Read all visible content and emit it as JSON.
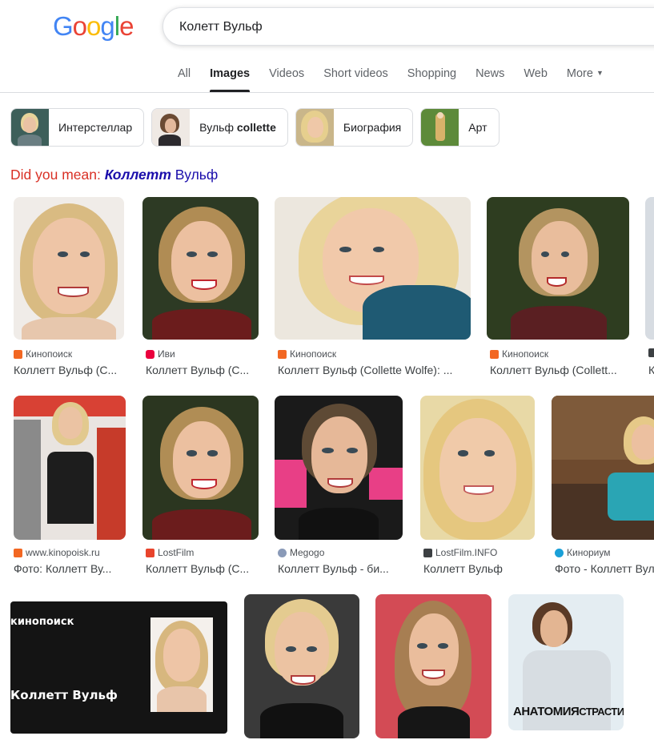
{
  "logo": [
    "G",
    "o",
    "o",
    "g",
    "l",
    "e"
  ],
  "logo_colors": [
    "#4285f4",
    "#ea4335",
    "#fbbc05",
    "#4285f4",
    "#34a853",
    "#ea4335"
  ],
  "search": {
    "value": "Колетт Вульф"
  },
  "tabs": [
    {
      "label": "All"
    },
    {
      "label": "Images",
      "active": true
    },
    {
      "label": "Videos"
    },
    {
      "label": "Short videos"
    },
    {
      "label": "Shopping"
    },
    {
      "label": "News"
    },
    {
      "label": "Web"
    },
    {
      "label": "More",
      "icon": "caret-down-icon"
    }
  ],
  "chips": [
    {
      "label": "Интерстеллар"
    },
    {
      "label_prefix": "Вульф ",
      "label_bold": "collette"
    },
    {
      "label": "Биография"
    },
    {
      "label": "Арт"
    }
  ],
  "spelling": {
    "prefix": "Did you mean: ",
    "suggestion_bold": "Коллетт",
    "suggestion_rest": " Вульф"
  },
  "results": [
    {
      "source": "Кинопоиск",
      "caption": "Коллетт Вульф (C...",
      "fav_color": "#f26722"
    },
    {
      "source": "Иви",
      "caption": "Коллетт Вульф (C...",
      "fav_color": "#ea003d"
    },
    {
      "source": "Кинопоиск",
      "caption": "Коллетт Вульф (Collette Wolfe): ...",
      "fav_color": "#f26722"
    },
    {
      "source": "Кинопоиск",
      "caption": "Коллетт Вульф (Collett...",
      "fav_color": "#f26722"
    },
    {
      "source": "",
      "caption": "К",
      "fav_color": "#3c4043"
    },
    {
      "source": "www.kinopoisk.ru",
      "caption": "Фото: Коллетт Ву...",
      "fav_color": "#f26722"
    },
    {
      "source": "LostFilm",
      "caption": "Коллетт Вульф (C...",
      "fav_color": "#e8442c"
    },
    {
      "source": "Megogo",
      "caption": "Коллетт Вульф - би...",
      "fav_color": "#8a9ab8"
    },
    {
      "source": "LostFilm.INFO",
      "caption": "Коллетт Вульф",
      "fav_color": "#3c4043"
    },
    {
      "source": "Кинориум",
      "caption": "Фото - Коллетт Вул",
      "fav_color": "#1aa0d8"
    }
  ],
  "promo_tile": {
    "brand": "кинопоиск",
    "name": "Коллетт Вульф"
  },
  "poster_tile": {
    "title_left": "АНАТОМИЯ",
    "title_right": "СТРАСТИ"
  }
}
